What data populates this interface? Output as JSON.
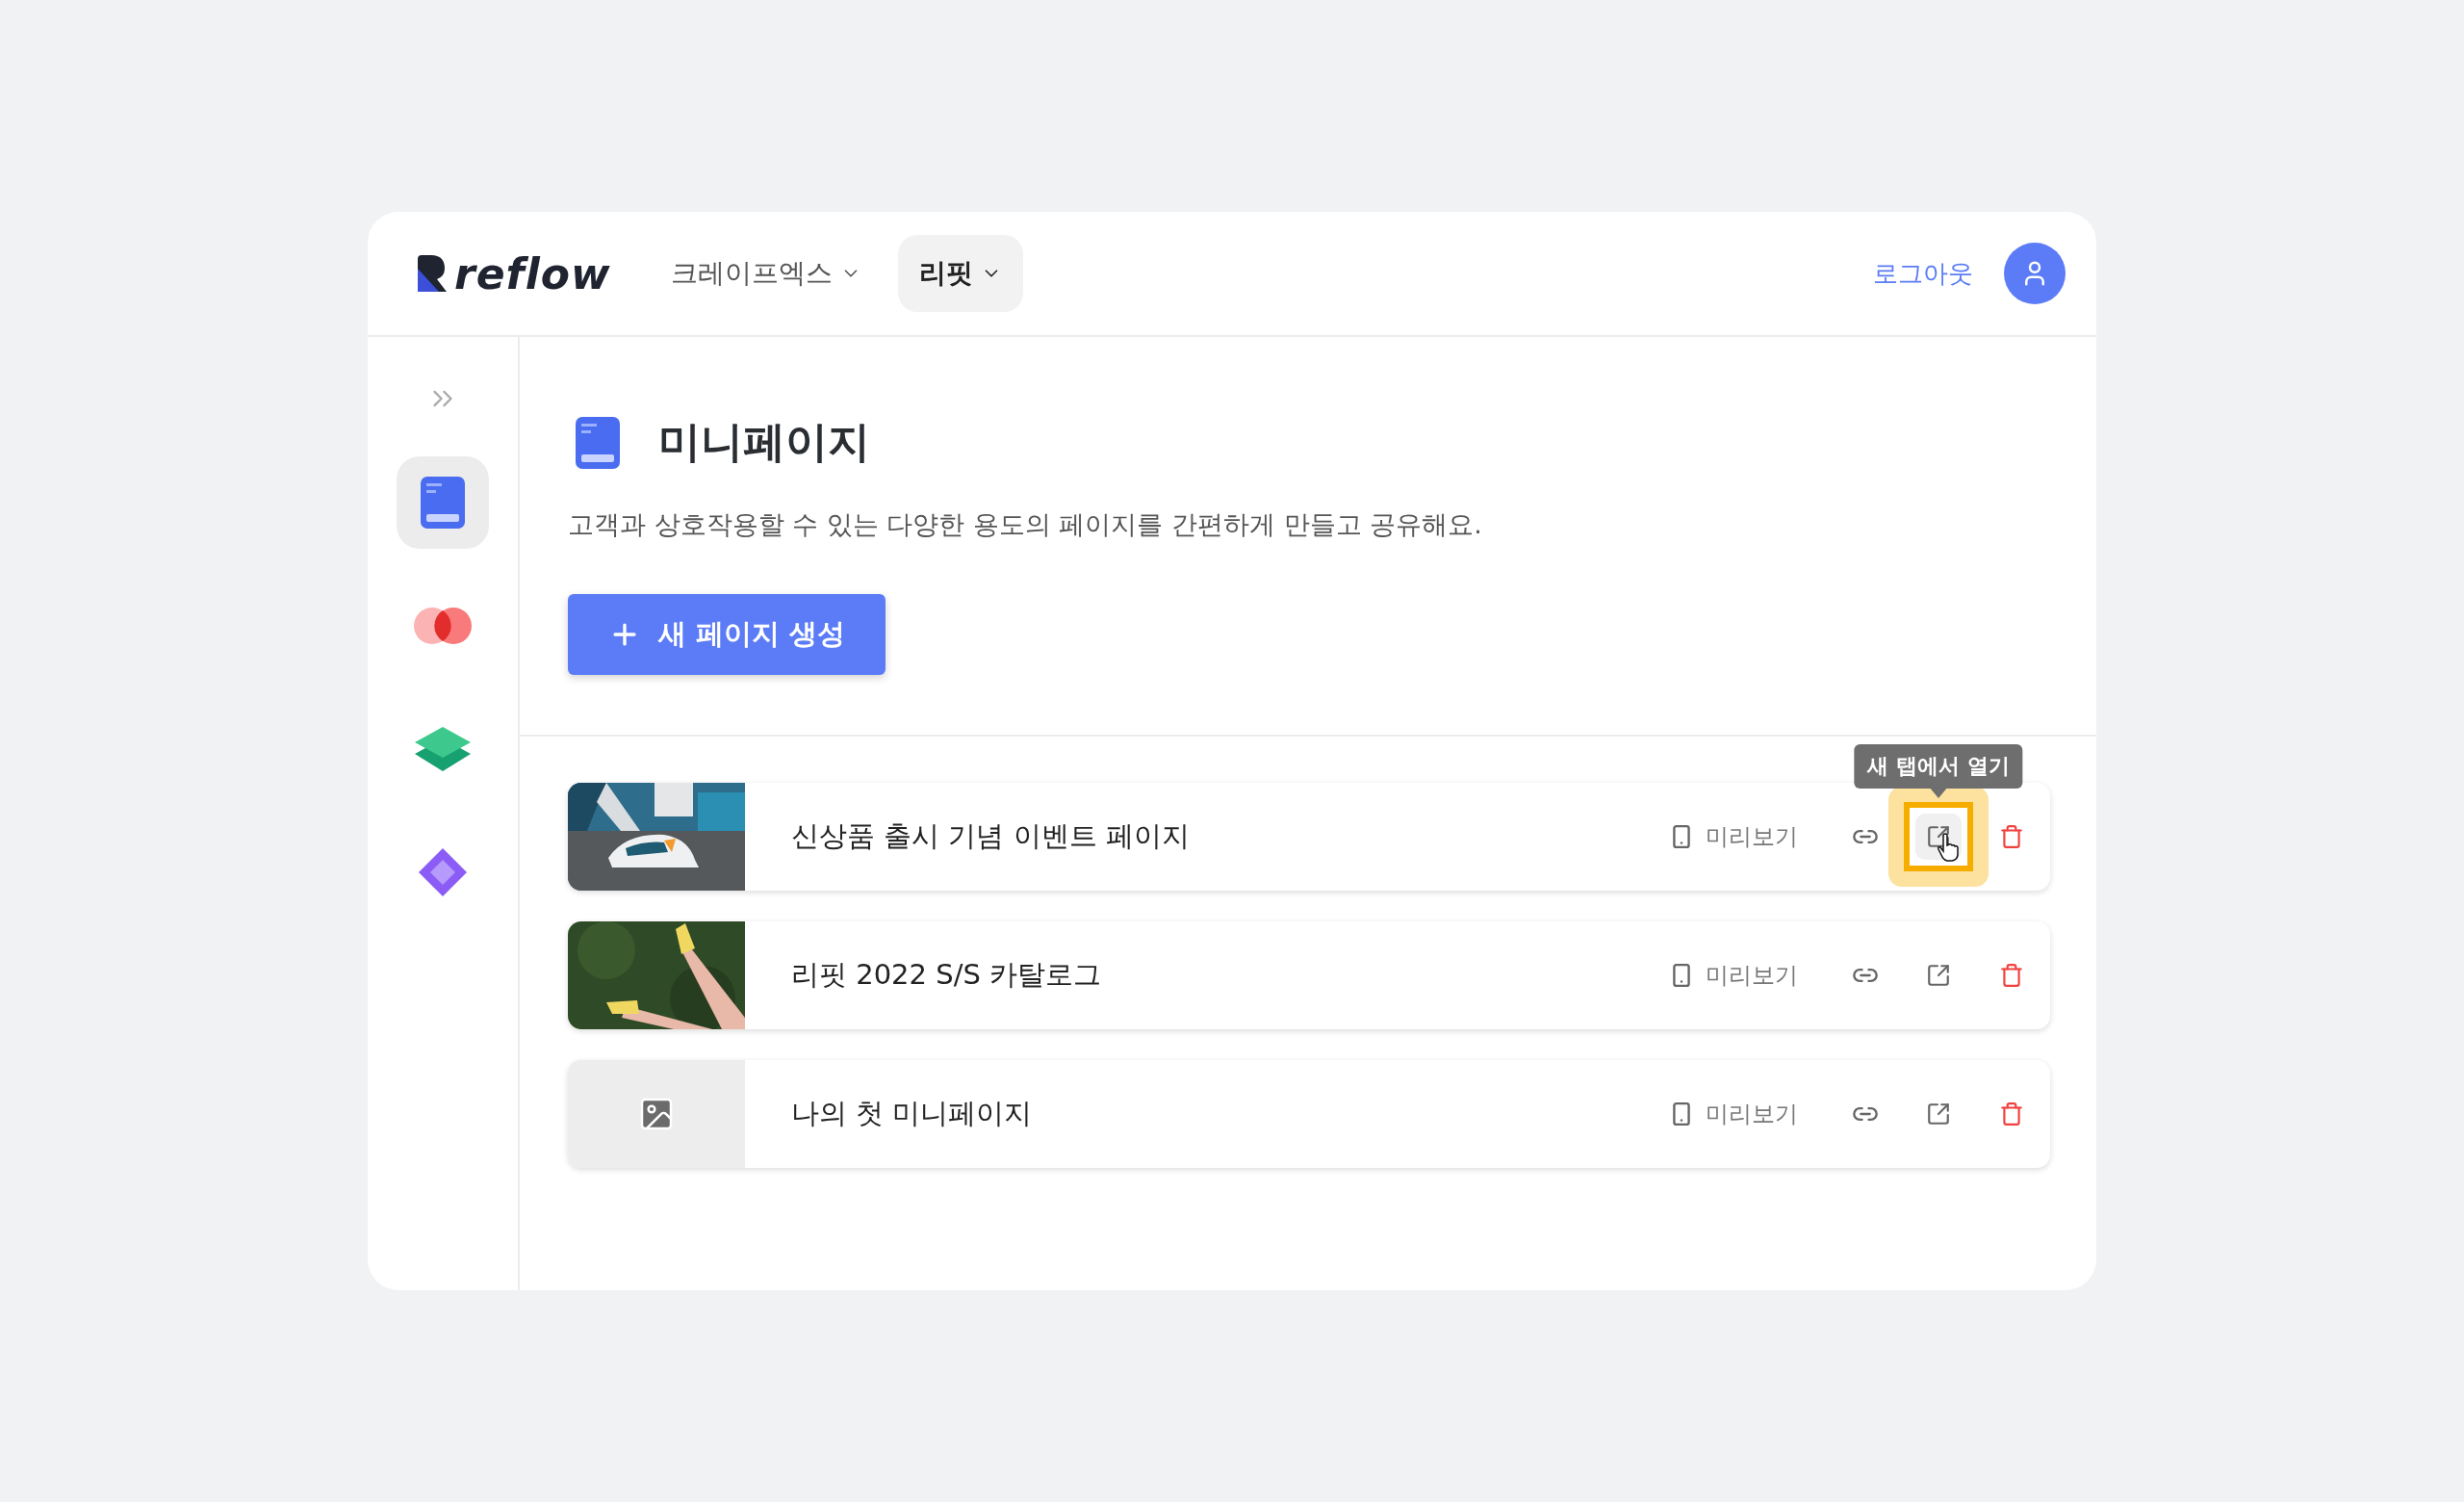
{
  "brand": {
    "name": "reflow"
  },
  "nav": [
    {
      "label": "크레이프엑스",
      "selected": false
    },
    {
      "label": "리핏",
      "selected": true
    }
  ],
  "logout": "로그아웃",
  "sidebar": {
    "items": [
      {
        "kind": "minipage",
        "selected": true
      },
      {
        "kind": "venn",
        "selected": false
      },
      {
        "kind": "layers",
        "selected": false
      },
      {
        "kind": "diamond",
        "selected": false
      }
    ]
  },
  "page": {
    "title": "미니페이지",
    "description": "고객과 상호작용할 수 있는 다양한 용도의 페이지를 간편하게 만들고 공유해요.",
    "create_button": "새 페이지 생성"
  },
  "pages": [
    {
      "title": "신상품 출시 기념 이벤트 페이지",
      "preview": "미리보기",
      "open_hovered": true,
      "tooltip": "새 탭에서 열기"
    },
    {
      "title": "리핏 2022 S/S 카탈로그",
      "preview": "미리보기",
      "open_hovered": false
    },
    {
      "title": "나의 첫 미니페이지",
      "thumbnail": {
        "kind": "placeholder"
      },
      "preview": "미리보기",
      "open_hovered": false
    }
  ]
}
